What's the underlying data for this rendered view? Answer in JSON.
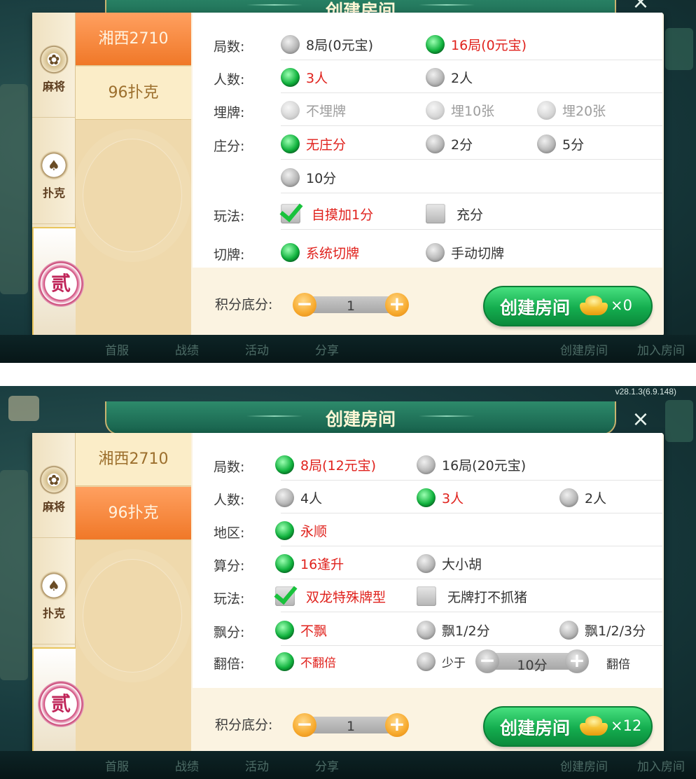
{
  "colors": {
    "selected_text": "#e0221d",
    "radio_on": "#11b33e",
    "accent_orange": "#f07828",
    "create_green": "#14ad4f"
  },
  "screen_a": {
    "title": "创建房间",
    "close_icon": "×",
    "categories": [
      {
        "label": "麻将",
        "icon": "mahjong-flower-icon"
      },
      {
        "label": "扑克",
        "icon": "spade-icon"
      }
    ],
    "badge_char": "贰",
    "games": [
      "湘西2710",
      "96扑克"
    ],
    "rows": [
      {
        "label": "局数:",
        "options": [
          "8局(0元宝)",
          "16局(0元宝)"
        ]
      },
      {
        "label": "人数:",
        "options": [
          "3人",
          "2人"
        ]
      },
      {
        "label": "埋牌:",
        "options": [
          "不埋牌",
          "埋10张",
          "埋20张"
        ]
      },
      {
        "label": "庄分:",
        "options": [
          "无庄分",
          "2分",
          "5分",
          "10分"
        ]
      },
      {
        "label": "玩法:",
        "options": [
          "自摸加1分",
          "充分"
        ]
      },
      {
        "label": "切牌:",
        "options": [
          "系统切牌",
          "手动切牌"
        ]
      }
    ],
    "footer": {
      "score_label": "积分底分:",
      "score_value": "1",
      "create_label": "创建房间",
      "cost": "×0"
    },
    "bottom_bar": [
      "首服",
      "战绩",
      "活动",
      "分享",
      "创建房间",
      "加入房间"
    ]
  },
  "screen_b": {
    "version": "v28.1.3(6.9.148)",
    "title": "创建房间",
    "close_icon": "×",
    "categories": [
      {
        "label": "麻将",
        "icon": "mahjong-flower-icon"
      },
      {
        "label": "扑克",
        "icon": "spade-icon"
      }
    ],
    "badge_char": "贰",
    "games": [
      "湘西2710",
      "96扑克"
    ],
    "rows": [
      {
        "label": "局数:",
        "options": [
          "8局(12元宝)",
          "16局(20元宝)"
        ]
      },
      {
        "label": "人数:",
        "options": [
          "4人",
          "3人",
          "2人"
        ]
      },
      {
        "label": "地区:",
        "options": [
          "永顺"
        ]
      },
      {
        "label": "算分:",
        "options": [
          "16逢升",
          "大小胡"
        ]
      },
      {
        "label": "玩法:",
        "options": [
          "双龙特殊牌型",
          "无牌打不抓猪"
        ]
      },
      {
        "label": "飘分:",
        "options": [
          "不飘",
          "飘1/2分",
          "飘1/2/3分"
        ]
      },
      {
        "label": "翻倍:",
        "options": [
          "不翻倍",
          "少于",
          "翻倍"
        ],
        "stepper_value": "10分"
      }
    ],
    "footer": {
      "score_label": "积分底分:",
      "score_value": "1",
      "create_label": "创建房间",
      "cost": "×12"
    },
    "bottom_bar": [
      "首服",
      "战绩",
      "活动",
      "分享",
      "创建房间",
      "加入房间"
    ]
  }
}
